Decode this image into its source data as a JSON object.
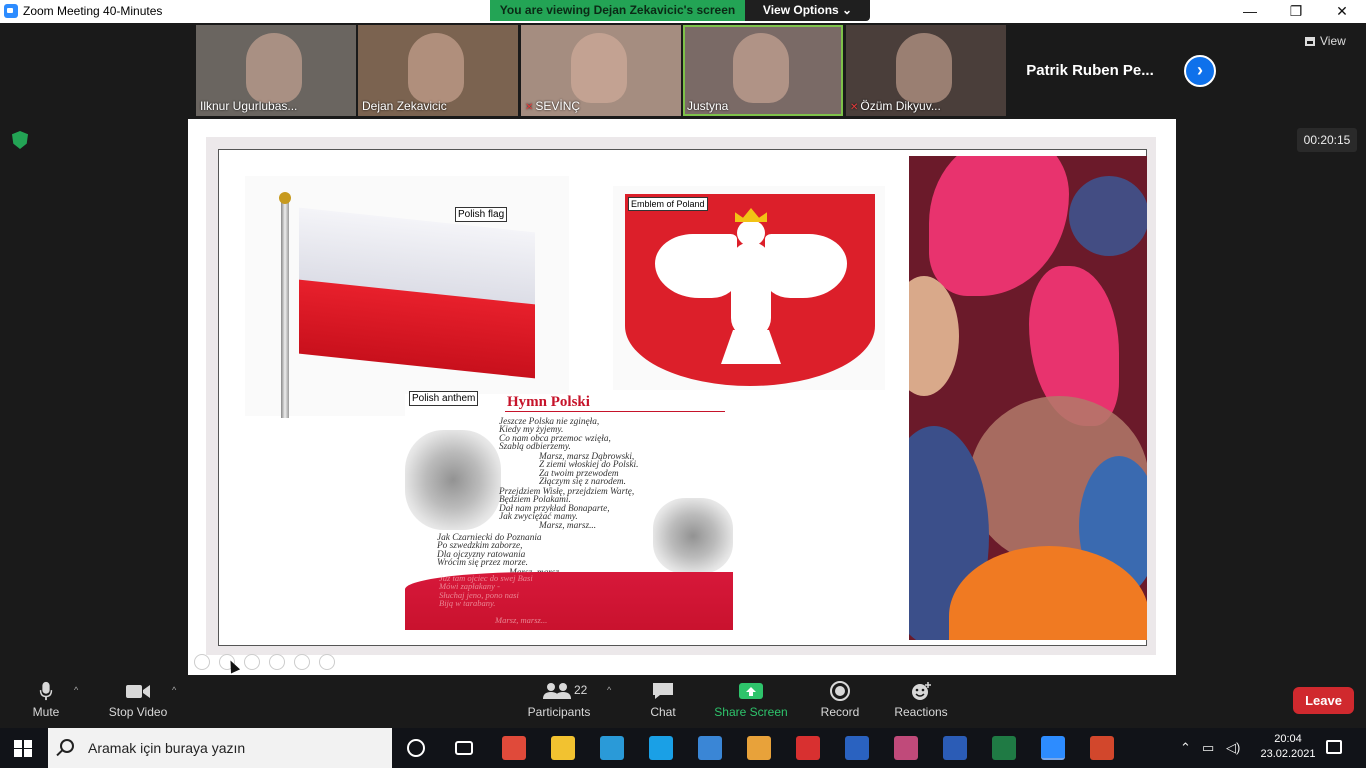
{
  "window": {
    "title": "Zoom Meeting 40-Minutes",
    "minimize": "—",
    "restore": "❐",
    "close": "✕"
  },
  "banner": {
    "viewing": "You are viewing Dejan Zekavicic's screen",
    "view_options": "View Options ⌄"
  },
  "participants": [
    {
      "name": "Ilknur Ugurlubas...",
      "muted": false,
      "tile_color": "#6a6560"
    },
    {
      "name": "Dejan Zekavicic",
      "muted": false,
      "tile_color": "#7b6350"
    },
    {
      "name": "SEVİNÇ",
      "muted": true,
      "tile_color": "#a58d80"
    },
    {
      "name": "Justyna",
      "muted": false,
      "tile_color": "#7a6a66",
      "active": true
    },
    {
      "name": "Özüm Dikyuv...",
      "muted": true,
      "tile_color": "#4a3e3a"
    }
  ],
  "name_only_tile": "Patrik Ruben Pe...",
  "mic_icon_glyph": "🎤",
  "next_glyph": "›",
  "view_label": "View",
  "timer": "00:20:15",
  "slide": {
    "flag_label": "Polish flag",
    "emblem_label": "Emblem of Poland",
    "anthem_label": "Polish anthem",
    "anthem_title": "Hymn Polski",
    "stanza1": "Jeszcze Polska nie zginęła,\nKiedy my żyjemy.\nCo nam obca przemoc wzięła,\nSzablą odbierzemy.",
    "chorus1": "Marsz, marsz Dąbrowski,\nZ ziemi włoskiej do Polski.\nZa twoim przewodem\nZłączym się z narodem.",
    "stanza2": "Przejdziem Wisłę, przejdziem Wartę,\nBędziem Polakami.\nDał nam przykład Bonaparte,\nJak zwyciężać mamy.",
    "chorus2": "Marsz, marsz...",
    "stanza3": "Jak Czarniecki do Poznania\nPo szwedzkim zaborze,\nDla ojczyzny ratowania\nWrócim się przez morze.",
    "chorus3": "Marsz, marsz...",
    "stanza4": "Już tam ojciec do swej Basi\nMówi zapłakany -\nSłuchaj jeno, pono nasi\nBiją w tarabany.",
    "chorus4": "Marsz, marsz..."
  },
  "toolbar": {
    "mute": "Mute",
    "stop_video": "Stop Video",
    "participants": "Participants",
    "participants_count": "22",
    "chat": "Chat",
    "share_screen": "Share Screen",
    "record": "Record",
    "reactions": "Reactions",
    "leave": "Leave",
    "caret": "^"
  },
  "taskbar": {
    "search_placeholder": "Aramak için buraya yazın",
    "time": "20:04",
    "date": "23.02.2021",
    "apps": [
      {
        "name": "cortana",
        "color": "#111318"
      },
      {
        "name": "task-view",
        "color": "#111318"
      },
      {
        "name": "chrome",
        "color": "#e04a3a"
      },
      {
        "name": "file-explorer",
        "color": "#f2c230"
      },
      {
        "name": "edge",
        "color": "#2a9ad8"
      },
      {
        "name": "skype",
        "color": "#1aa0e6"
      },
      {
        "name": "mail",
        "color": "#3a86d6"
      },
      {
        "name": "store",
        "color": "#e8a23a"
      },
      {
        "name": "gift",
        "color": "#d83030"
      },
      {
        "name": "outlook-like",
        "color": "#2a62c0"
      },
      {
        "name": "snip",
        "color": "#c04a7a"
      },
      {
        "name": "word",
        "color": "#2b5cb6"
      },
      {
        "name": "excel",
        "color": "#1f7a44"
      },
      {
        "name": "zoom",
        "color": "#2d8cff"
      },
      {
        "name": "powerpoint",
        "color": "#d2472c"
      }
    ]
  },
  "colors": {
    "accent_blue": "#0e71eb",
    "share_green": "#2ec36b",
    "leave_red": "#d0292e"
  }
}
